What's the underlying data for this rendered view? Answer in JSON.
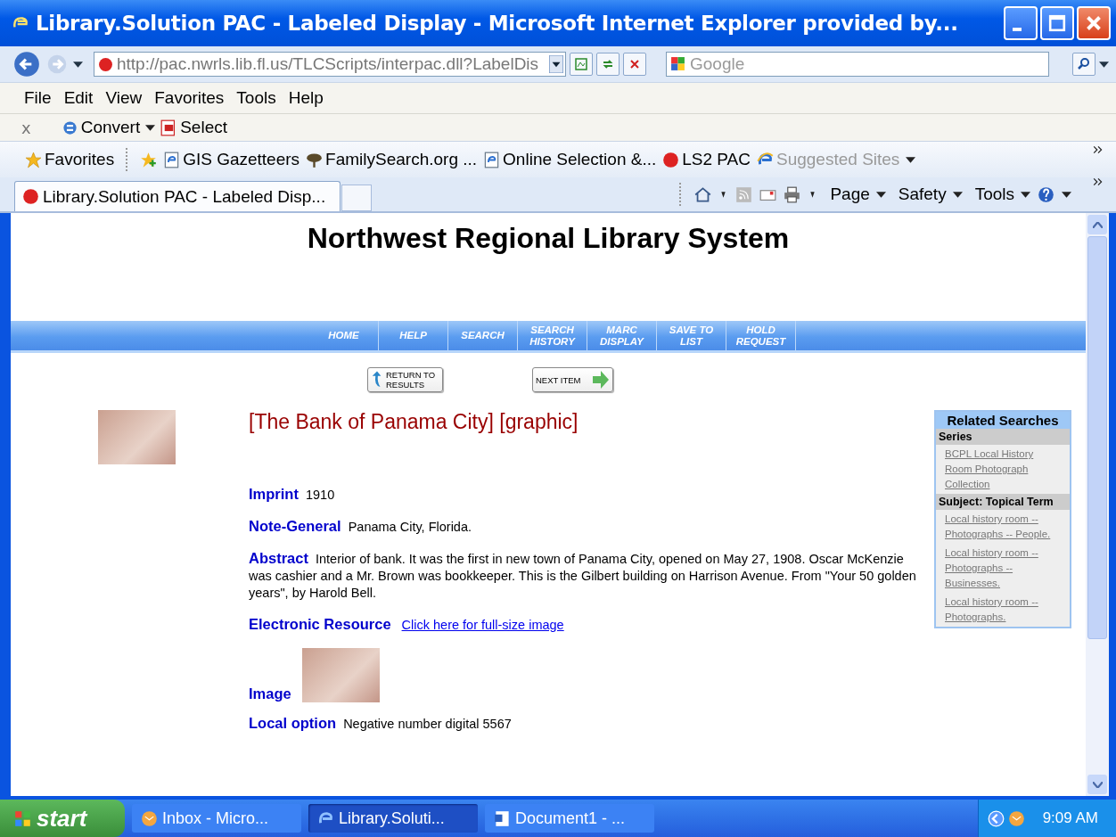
{
  "window": {
    "title": "Library.Solution PAC - Labeled Display - Microsoft Internet Explorer provided by..."
  },
  "address_bar": {
    "url": "http://pac.nwrls.lib.fl.us/TLCScripts/interpac.dll?LabelDis",
    "search_placeholder": "Google"
  },
  "menu": [
    "File",
    "Edit",
    "View",
    "Favorites",
    "Tools",
    "Help"
  ],
  "toolbar": {
    "close": "x",
    "convert": "Convert",
    "select": "Select"
  },
  "favorites_bar": {
    "label": "Favorites",
    "items": [
      {
        "label": "GIS Gazetteers",
        "kind": "page",
        "dimmed": false
      },
      {
        "label": "FamilySearch.org ...",
        "kind": "tree",
        "dimmed": false
      },
      {
        "label": "Online Selection &...",
        "kind": "page",
        "dimmed": false
      },
      {
        "label": "LS2 PAC",
        "kind": "badge",
        "dimmed": false
      },
      {
        "label": "Suggested Sites",
        "kind": "menu",
        "dimmed": true
      }
    ]
  },
  "tabs": [
    {
      "label": "Library.Solution PAC - Labeled Disp...",
      "selected": true
    }
  ],
  "command_bar": [
    "Page",
    "Safety",
    "Tools"
  ],
  "page": {
    "heading": "Northwest Regional Library System",
    "nav": [
      "HOME",
      "HELP",
      "SEARCH",
      "SEARCH HISTORY",
      "MARC DISPLAY",
      "SAVE TO LIST",
      "HOLD REQUEST"
    ],
    "return_button": "RETURN TO RESULTS",
    "next_button": "NEXT ITEM",
    "record_title": "[The Bank of Panama City] [graphic]",
    "fields": [
      {
        "label": "Imprint",
        "kind": "text",
        "value": "1910"
      },
      {
        "label": "Note-General",
        "kind": "text",
        "value": "Panama City, Florida."
      },
      {
        "label": "Abstract",
        "kind": "text",
        "value": "Interior of bank. It was the first in new town of Panama City, opened on May 27, 1908. Oscar McKenzie was cashier and a Mr. Brown was bookkeeper. This is the Gilbert building on Harrison Avenue. From \"Your 50 golden years\", by Harold Bell."
      },
      {
        "label": "Electronic Resource",
        "kind": "link",
        "value": "Click here for full-size image"
      },
      {
        "label": "Image",
        "kind": "image"
      },
      {
        "label": "Local option",
        "kind": "text",
        "value": "Negative number digital 5567"
      }
    ],
    "related": {
      "title": "Related Searches",
      "sections": [
        {
          "heading": "Series",
          "links": [
            "BCPL Local History Room Photograph Collection"
          ]
        },
        {
          "heading": "Subject: Topical Term",
          "links": [
            "Local history room -- Photographs -- People.",
            "Local history room -- Photographs -- Businesses.",
            "Local history room -- Photographs."
          ]
        }
      ]
    }
  },
  "taskbar": {
    "start": "start",
    "tasks": [
      {
        "label": "Inbox - Micro...",
        "kind": "mail",
        "selected": false
      },
      {
        "label": "Library.Soluti...",
        "kind": "browser",
        "selected": true
      },
      {
        "label": "Document1 - ...",
        "kind": "doc",
        "selected": false
      }
    ],
    "clock": "9:09 AM"
  }
}
